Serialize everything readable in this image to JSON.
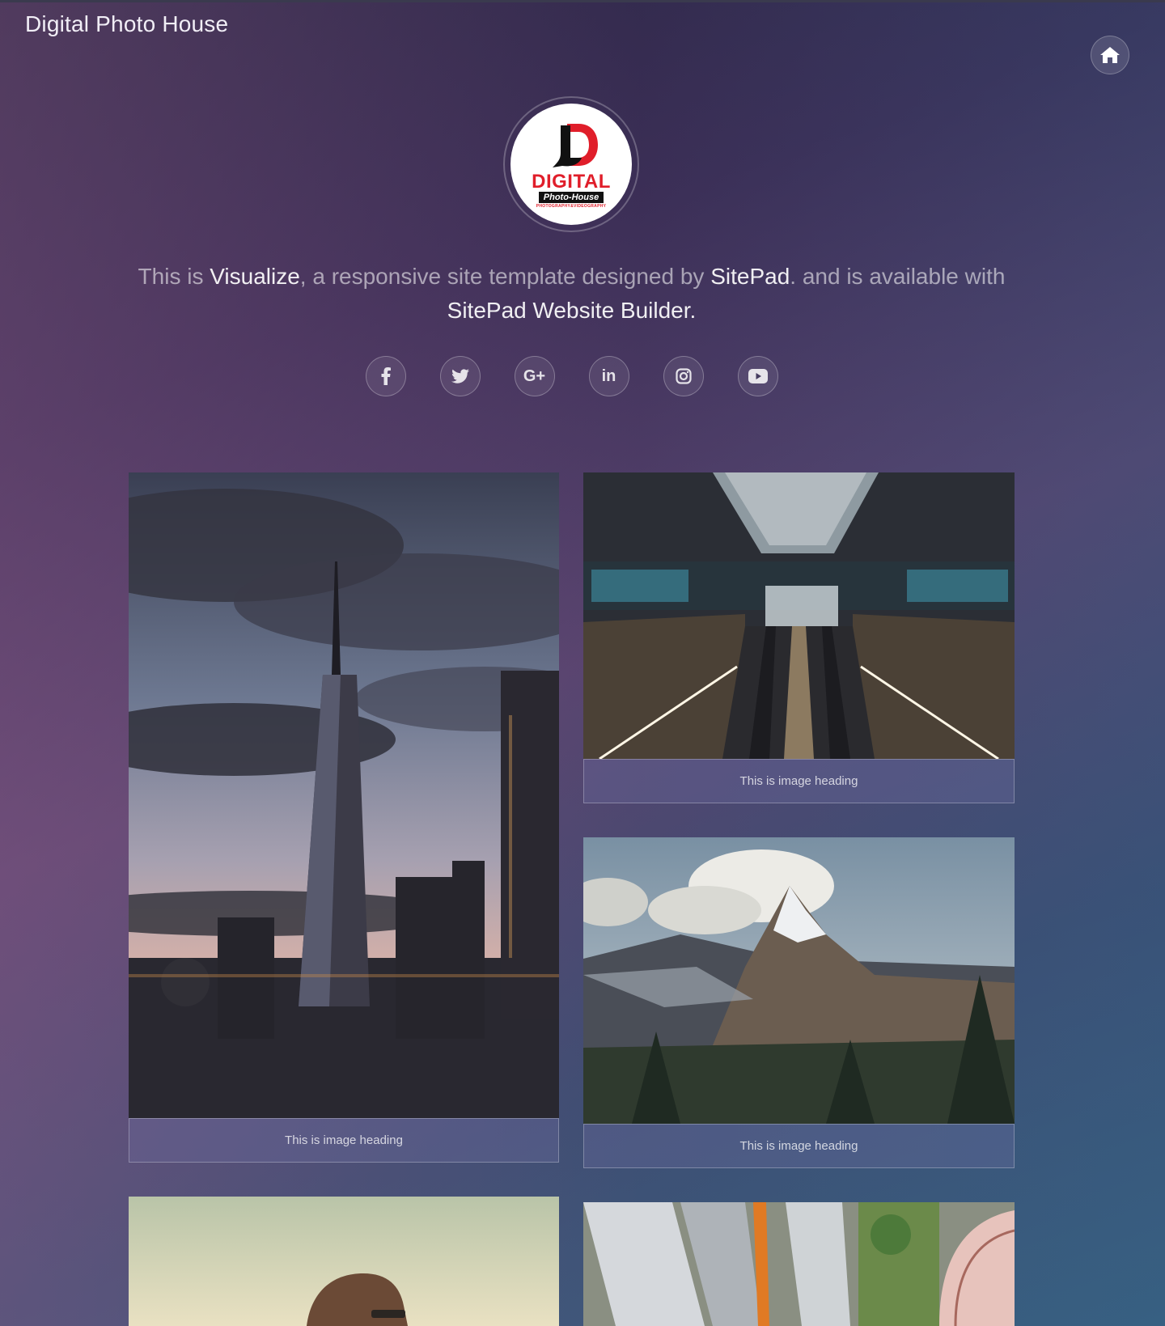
{
  "header": {
    "site_title": "Digital Photo House",
    "home_icon": "home-icon"
  },
  "logo": {
    "word": "DIGITAL",
    "sub": "Photo-House",
    "tiny": "PHOTOGRAPHY&VIDEOGRAPHY"
  },
  "intro": {
    "part1": "This is ",
    "visualize": "Visualize",
    "part2": ", a responsive site template designed by ",
    "sitepad": "SitePad",
    "part3": ". and is available with ",
    "builder": "SitePad Website Builder",
    "part4": "."
  },
  "socials": [
    {
      "name": "facebook-icon",
      "glyph": "f"
    },
    {
      "name": "twitter-icon",
      "glyph": "t"
    },
    {
      "name": "google-plus-icon",
      "glyph": "G+"
    },
    {
      "name": "linkedin-icon",
      "glyph": "in"
    },
    {
      "name": "instagram-icon",
      "glyph": "ig"
    },
    {
      "name": "youtube-icon",
      "glyph": "yt"
    }
  ],
  "gallery": {
    "caption_1": "This is image heading",
    "caption_2": "This is image heading",
    "caption_3": "This is image heading"
  },
  "colors": {
    "logo_red": "#e01e2a",
    "bg_top": "#2b2745",
    "bg_bottom": "#3c6282"
  }
}
